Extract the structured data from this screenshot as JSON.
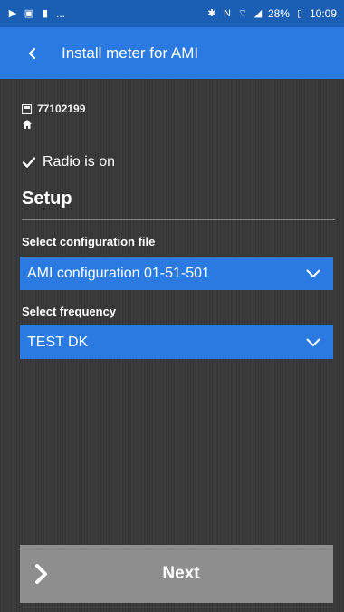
{
  "status_bar": {
    "time": "10:09",
    "battery": "28%",
    "left_dots": "..."
  },
  "app_bar": {
    "title": "Install meter for AMI",
    "back_icon": "back-chevron-icon"
  },
  "meter": {
    "id": "77102199"
  },
  "radio": {
    "status_text": "Radio is on"
  },
  "setup": {
    "heading": "Setup",
    "config_label": "Select configuration file",
    "config_value": "AMI configuration 01-51-501",
    "frequency_label": "Select frequency",
    "frequency_value": "TEST DK"
  },
  "footer": {
    "next_label": "Next"
  },
  "colors": {
    "status_bar": "#1a5fb4",
    "accent": "#2a7ae2",
    "background": "#3b3b3b",
    "next_button": "#8e8e8e"
  }
}
